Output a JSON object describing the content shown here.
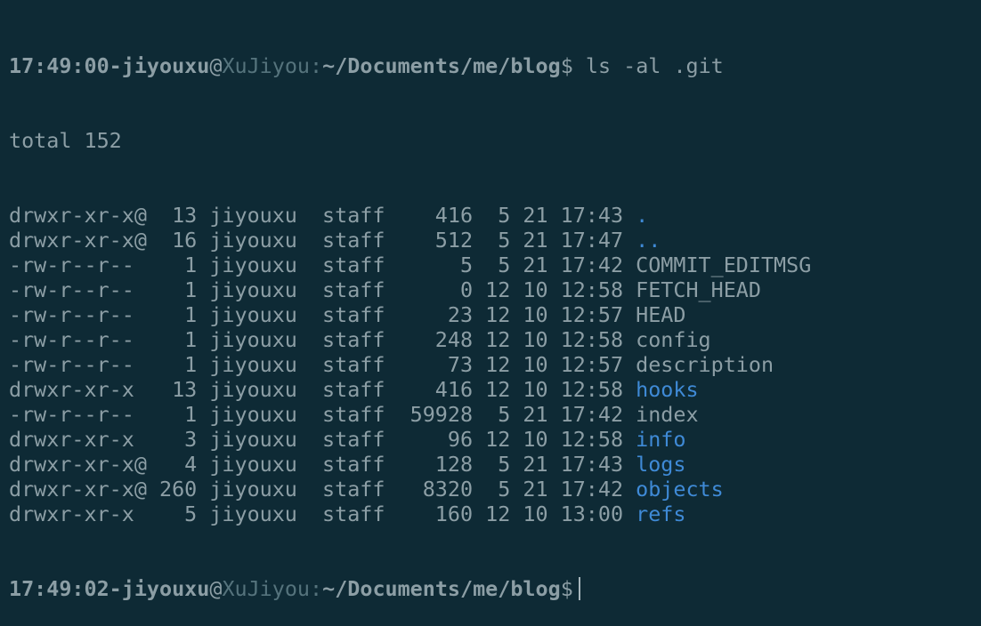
{
  "colors": {
    "background": "#0e2a35",
    "text": "#8c9ea5",
    "host": "#55737c",
    "directory": "#3f8ad6"
  },
  "prompt1": {
    "time": "17:49:00",
    "sep": "-",
    "user": "jiyouxu",
    "at": "@",
    "host": "XuJiyou",
    "colon": ":",
    "path": "~/Documents/me/blog",
    "dollar": "$",
    "command": " ls -al .git"
  },
  "total": "total 152",
  "listing": [
    {
      "meta": "drwxr-xr-x@  13 jiyouxu  staff    416  5 21 17:43 ",
      "name": ".",
      "is_dir": true
    },
    {
      "meta": "drwxr-xr-x@  16 jiyouxu  staff    512  5 21 17:47 ",
      "name": "..",
      "is_dir": true
    },
    {
      "meta": "-rw-r--r--    1 jiyouxu  staff      5  5 21 17:42 ",
      "name": "COMMIT_EDITMSG",
      "is_dir": false
    },
    {
      "meta": "-rw-r--r--    1 jiyouxu  staff      0 12 10 12:58 ",
      "name": "FETCH_HEAD",
      "is_dir": false
    },
    {
      "meta": "-rw-r--r--    1 jiyouxu  staff     23 12 10 12:57 ",
      "name": "HEAD",
      "is_dir": false
    },
    {
      "meta": "-rw-r--r--    1 jiyouxu  staff    248 12 10 12:58 ",
      "name": "config",
      "is_dir": false
    },
    {
      "meta": "-rw-r--r--    1 jiyouxu  staff     73 12 10 12:57 ",
      "name": "description",
      "is_dir": false
    },
    {
      "meta": "drwxr-xr-x   13 jiyouxu  staff    416 12 10 12:58 ",
      "name": "hooks",
      "is_dir": true
    },
    {
      "meta": "-rw-r--r--    1 jiyouxu  staff  59928  5 21 17:42 ",
      "name": "index",
      "is_dir": false
    },
    {
      "meta": "drwxr-xr-x    3 jiyouxu  staff     96 12 10 12:58 ",
      "name": "info",
      "is_dir": true
    },
    {
      "meta": "drwxr-xr-x@   4 jiyouxu  staff    128  5 21 17:43 ",
      "name": "logs",
      "is_dir": true
    },
    {
      "meta": "drwxr-xr-x@ 260 jiyouxu  staff   8320  5 21 17:42 ",
      "name": "objects",
      "is_dir": true
    },
    {
      "meta": "drwxr-xr-x    5 jiyouxu  staff    160 12 10 13:00 ",
      "name": "refs",
      "is_dir": true
    }
  ],
  "prompt2": {
    "time": "17:49:02",
    "sep": "-",
    "user": "jiyouxu",
    "at": "@",
    "host": "XuJiyou",
    "colon": ":",
    "path": "~/Documents/me/blog",
    "dollar": "$",
    "command": " "
  }
}
